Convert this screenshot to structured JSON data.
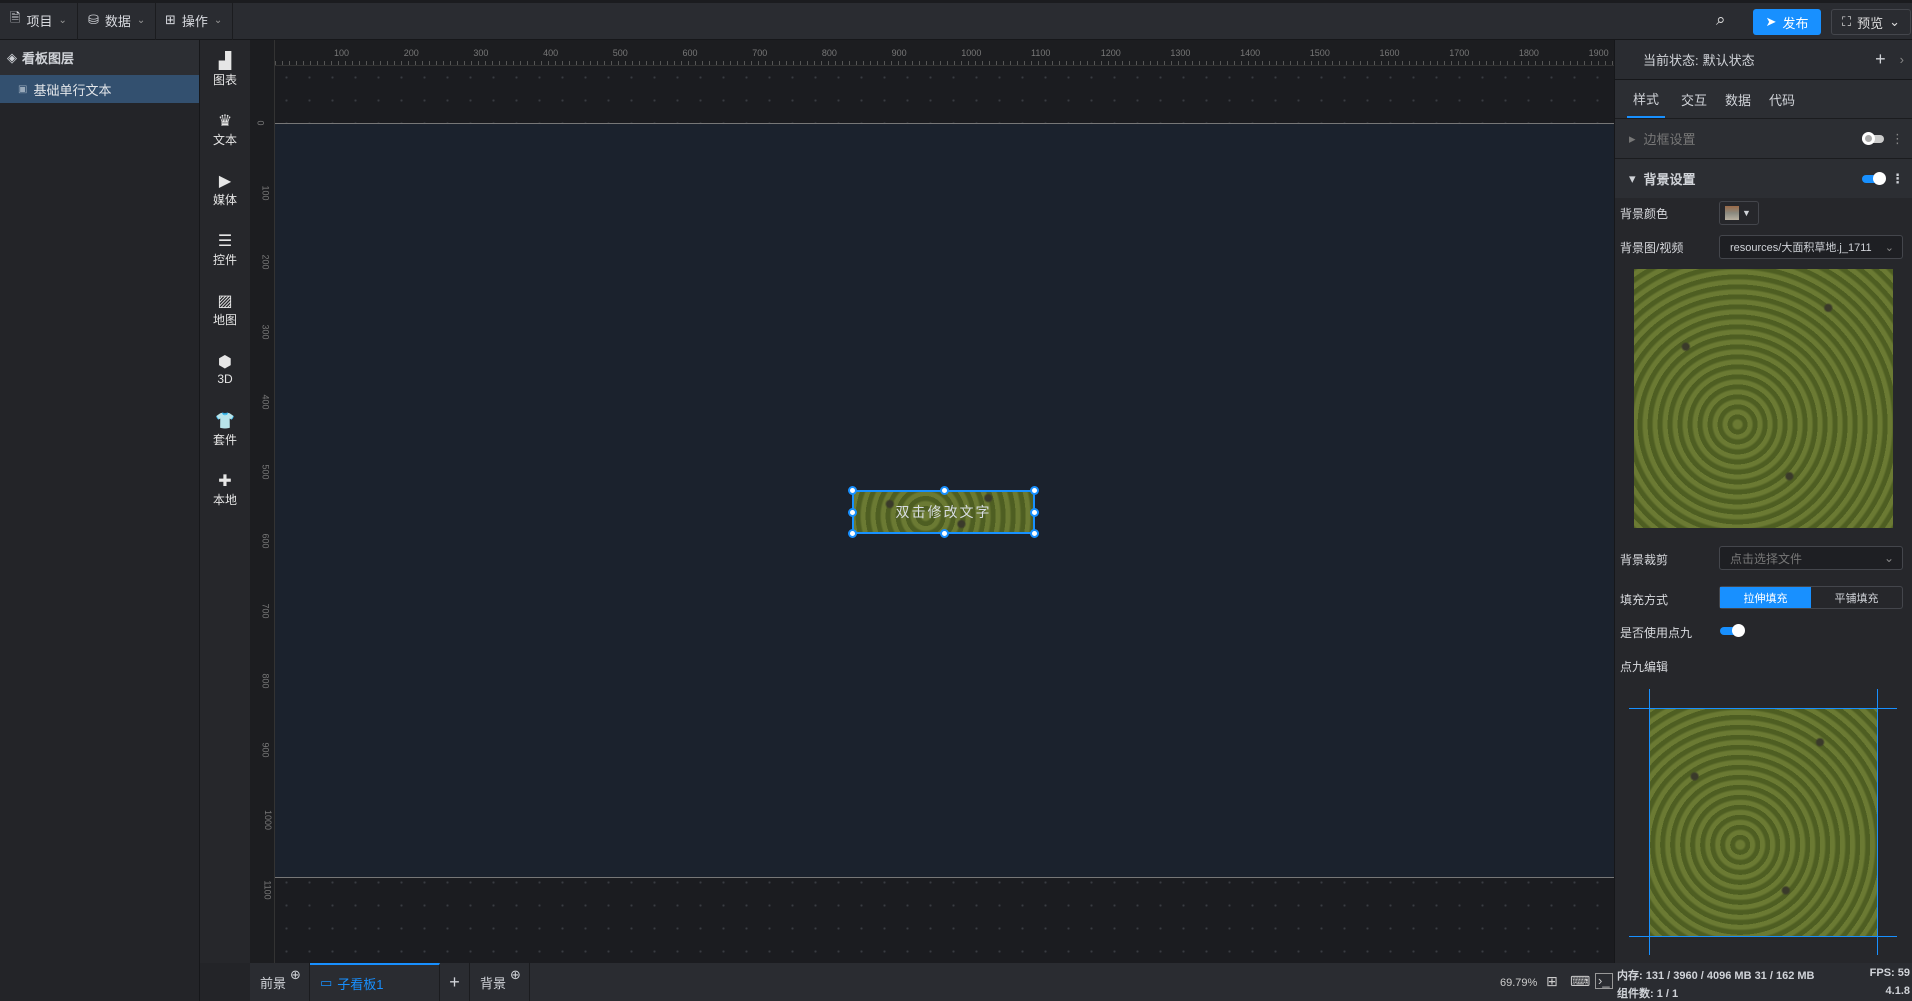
{
  "topbar": {
    "menus": [
      {
        "icon": "file-icon",
        "label": "项目"
      },
      {
        "icon": "database-icon",
        "label": "数据"
      },
      {
        "icon": "grid-icon",
        "label": "操作"
      }
    ],
    "publish": "发布",
    "preview": "预览"
  },
  "layers": {
    "title": "看板图层",
    "items": [
      {
        "label": "基础单行文本",
        "selected": true
      }
    ]
  },
  "tools": [
    {
      "icon": "chart-icon",
      "label": "图表"
    },
    {
      "icon": "text-icon",
      "label": "文本"
    },
    {
      "icon": "media-icon",
      "label": "媒体"
    },
    {
      "icon": "control-icon",
      "label": "控件"
    },
    {
      "icon": "map-icon",
      "label": "地图"
    },
    {
      "icon": "cube-icon",
      "label": "3D"
    },
    {
      "icon": "shirt-icon",
      "label": "套件"
    },
    {
      "icon": "puzzle-icon",
      "label": "本地"
    }
  ],
  "ruler": {
    "h": [
      "100",
      "200",
      "300",
      "400",
      "500",
      "600",
      "700",
      "800",
      "900",
      "1000",
      "1100",
      "1200",
      "1300",
      "1400",
      "1500",
      "1600",
      "1700",
      "1800",
      "1900"
    ],
    "v": [
      "0",
      "100",
      "200",
      "300",
      "400",
      "500",
      "600",
      "700",
      "800",
      "900",
      "1000",
      "1100"
    ]
  },
  "canvas": {
    "widget_text": "双击修改文字"
  },
  "bottom": {
    "foreground": "前景",
    "subboard": "子看板1",
    "add": "+",
    "background": "背景",
    "zoom": "69.79%"
  },
  "right": {
    "state_label": "当前状态:",
    "state_value": "默认状态",
    "tabs": [
      "样式",
      "交互",
      "数据",
      "代码"
    ],
    "border_section": "边框设置",
    "border_enabled": false,
    "bg_section": "背景设置",
    "bg_enabled": true,
    "bg_color_label": "背景颜色",
    "bg_image_label": "背景图/视频",
    "bg_image_value": "resources/大面积草地.j_1711",
    "bg_crop_label": "背景裁剪",
    "bg_crop_placeholder": "点击选择文件",
    "fill_label": "填充方式",
    "fill_options": [
      "拉伸填充",
      "平铺填充"
    ],
    "fill_selected": "拉伸填充",
    "ninepatch_label": "是否使用点九",
    "ninepatch_enabled": true,
    "ninepatch_edit_label": "点九编辑"
  },
  "status": {
    "memory": "内存: 131 / 3960 / 4096 MB  31 / 162 MB",
    "fps": "FPS: 59",
    "components": "组件数: 1 / 1",
    "version": "4.1.8"
  },
  "colors": {
    "accent": "#1890ff",
    "board": "#1b222d"
  }
}
